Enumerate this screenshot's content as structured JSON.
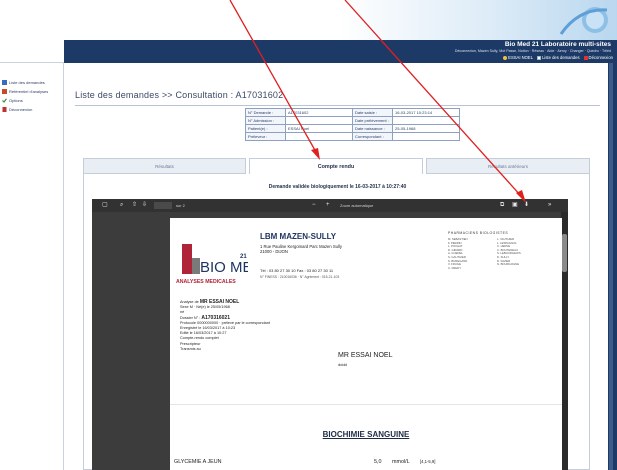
{
  "header": {
    "app_title": "Bio Med 21 Laboratoire multi-sites",
    "app_sub": "Déconnexion, Mazen Sully, Mot Passe, Notion · Réseau · Aide · Aeroy · Changer · Quedro · Téléd",
    "actions": [
      {
        "label": "ESSAI NOEL",
        "icon": "user-dot-icon"
      },
      {
        "label": "Liste des demandes",
        "icon": "list-icon"
      },
      {
        "label": "Déconnexion",
        "icon": "logout-icon"
      }
    ]
  },
  "sidebar": {
    "items": [
      {
        "label": "Liste des demandes",
        "icon": "list-icon",
        "color": "#3a6bc0"
      },
      {
        "label": "Référentiel d'analyses",
        "icon": "book-icon",
        "color": "#c84a2d"
      },
      {
        "label": "Options",
        "icon": "check-icon",
        "color": "#3a8a3a"
      },
      {
        "label": "Déconnexion",
        "icon": "exit-icon",
        "color": "#c0302c"
      }
    ]
  },
  "main": {
    "page_title": "Liste des demandes >> Consultation : A17031602",
    "info": {
      "rows": [
        {
          "l1": "N° Demande :",
          "v1": "A17031602",
          "l2": "Date saisie :",
          "v2": "16-03-2017 10:23:14"
        },
        {
          "l1": "N° Admission :",
          "v1": "",
          "l2": "Date prélèvement :",
          "v2": ""
        },
        {
          "l1": "Patient(e) :",
          "v1": "ESSAI Noel",
          "l2": "Date naissance :",
          "v2": "25-05-1968"
        },
        {
          "l1": "Préleveur :",
          "v1": "",
          "l2": "Correspondant :",
          "v2": ""
        }
      ]
    },
    "tabs": [
      {
        "label": "Résultats",
        "active": false
      },
      {
        "label": "Compte rendu",
        "active": true
      },
      {
        "label": "Résultats antérieurs",
        "active": false
      }
    ],
    "validated_text": "Demande validée biologiquement le 16-03-2017 à 10:27:40"
  },
  "pdf": {
    "page_indicator": "sur 2",
    "zoom": "Zoom automatique",
    "lab": {
      "name": "LBM MAZEN-SULLY",
      "address_1": "1 Rue Pauline Kergomard  Parc Mazen Sully",
      "address_2": "21000 - DIJON",
      "tel": "Tél : 03 80 27 30 10    Fax : 03 80 27 30 11",
      "finess": "N° FINESS : 210016036 · N° Agrément : 015-21-103",
      "logo_text": "BIO MED",
      "logo_sup": "21",
      "subtitle": "ANALYSES MEDICALES"
    },
    "pharmaciens_title": "PHARMACIENS   BIOLOGISTES",
    "pharmaciens": [
      "M. SEBASTIEN",
      "F. PERRIN",
      "L. POCHAT",
      "D. GIRARD",
      "A. GUEDEL",
      "S. GAUTHIER",
      "S. BUREGAND",
      "V. FRUGE",
      "C. FREDY",
      "L. VAUTHIER",
      "L. LESPAGNOL",
      "C. HERVE",
      "C. BOUTENEAU",
      "S. LEBOURGEOIS",
      "D. SULLY",
      "D. FAVIER",
      "N. BOURGOGNE"
    ],
    "patient_block": {
      "line_1_label": "Analyse de ",
      "line_1_name": "MR ESSAI NOEL",
      "line_2": "Sexe M · Né(e) le 25/05/1968",
      "line_3": "né",
      "line_4_label": "Dossier N° : ",
      "line_4_value": "A170316021",
      "line_5": "Protocole 0000000000 · prélevé par le correspondant",
      "line_6": "Enregistré le 16/03/2017 à 10:23",
      "line_7": "Edité le 16/03/2017 à 10:27",
      "line_8": "Compte-rendu complet",
      "line_9": "Prescripteur",
      "line_10": "Transmis au"
    },
    "patient_name": "MR ESSAI NOEL",
    "patient_addr": "dddd",
    "section_title": "BIOCHIMIE SANGUINE",
    "exam": {
      "name": "GLYCEMIE A JEUN",
      "value": "5,0",
      "unit": "mmol/L",
      "ref": "[4,1-5,9]"
    }
  }
}
